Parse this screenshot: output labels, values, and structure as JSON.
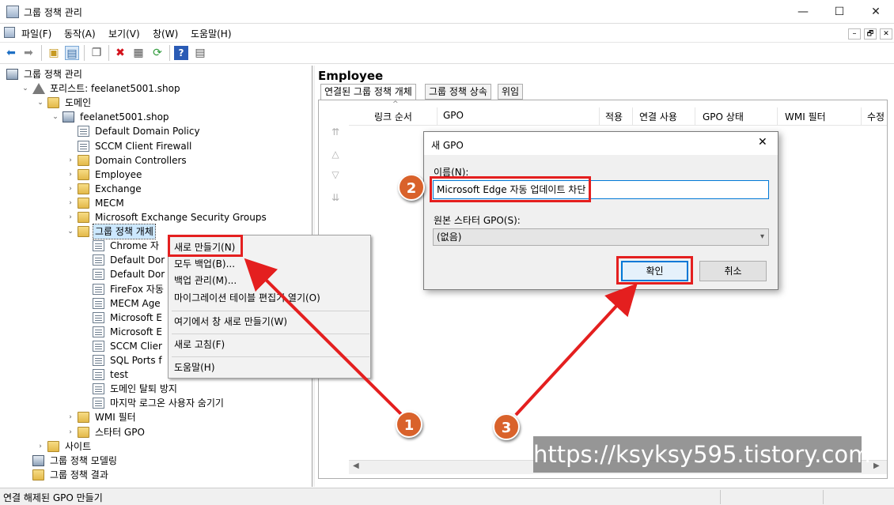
{
  "window": {
    "title": "그룹 정책 관리",
    "minimize": "—",
    "maximize": "☐",
    "close": "✕"
  },
  "menu": [
    "파일(F)",
    "동작(A)",
    "보기(V)",
    "창(W)",
    "도움말(H)"
  ],
  "mdi_controls": [
    "–",
    "🗗",
    "✕"
  ],
  "toolbar_icons": [
    "back-arrow-icon",
    "forward-arrow-icon",
    "folder-up-icon",
    "console-tree-icon",
    "copy-icon",
    "delete-icon",
    "properties-icon",
    "refresh-icon",
    "help-icon",
    "export-icon"
  ],
  "tree": [
    {
      "label": "그룹 정책 관리",
      "icon": "dom",
      "indent": 0,
      "twisty": ""
    },
    {
      "label": "포리스트: feelanet5001.shop",
      "icon": "tri",
      "indent": 1,
      "twisty": "⌄"
    },
    {
      "label": "도메인",
      "icon": "folder",
      "indent": 2,
      "twisty": "⌄"
    },
    {
      "label": "feelanet5001.shop",
      "icon": "dom",
      "indent": 3,
      "twisty": "⌄"
    },
    {
      "label": "Default Domain Policy",
      "icon": "doc",
      "indent": 4,
      "twisty": ""
    },
    {
      "label": "SCCM Client Firewall",
      "icon": "doc",
      "indent": 4,
      "twisty": ""
    },
    {
      "label": "Domain Controllers",
      "icon": "folder",
      "indent": 4,
      "twisty": "›"
    },
    {
      "label": "Employee",
      "icon": "folder",
      "indent": 4,
      "twisty": "›"
    },
    {
      "label": "Exchange",
      "icon": "folder",
      "indent": 4,
      "twisty": "›"
    },
    {
      "label": "MECM",
      "icon": "folder",
      "indent": 4,
      "twisty": "›"
    },
    {
      "label": "Microsoft Exchange Security Groups",
      "icon": "folder",
      "indent": 4,
      "twisty": "›"
    },
    {
      "label": "그룹 정책 개체",
      "icon": "folder",
      "indent": 4,
      "twisty": "⌄",
      "selected": true
    },
    {
      "label": "Chrome 자",
      "icon": "doc",
      "indent": 5,
      "twisty": ""
    },
    {
      "label": "Default Dor",
      "icon": "doc",
      "indent": 5,
      "twisty": ""
    },
    {
      "label": "Default Dor",
      "icon": "doc",
      "indent": 5,
      "twisty": ""
    },
    {
      "label": "FireFox 자동",
      "icon": "doc",
      "indent": 5,
      "twisty": ""
    },
    {
      "label": "MECM Age",
      "icon": "doc",
      "indent": 5,
      "twisty": ""
    },
    {
      "label": "Microsoft E",
      "icon": "doc",
      "indent": 5,
      "twisty": ""
    },
    {
      "label": "Microsoft E",
      "icon": "doc",
      "indent": 5,
      "twisty": ""
    },
    {
      "label": "SCCM Clier",
      "icon": "doc",
      "indent": 5,
      "twisty": ""
    },
    {
      "label": "SQL Ports f",
      "icon": "doc",
      "indent": 5,
      "twisty": ""
    },
    {
      "label": "test",
      "icon": "doc",
      "indent": 5,
      "twisty": ""
    },
    {
      "label": "도메인 탈퇴 방지",
      "icon": "doc",
      "indent": 5,
      "twisty": ""
    },
    {
      "label": "마지막 로그온 사용자 숨기기",
      "icon": "doc",
      "indent": 5,
      "twisty": ""
    },
    {
      "label": "WMI 필터",
      "icon": "folder",
      "indent": 4,
      "twisty": "›"
    },
    {
      "label": "스타터 GPO",
      "icon": "folder",
      "indent": 4,
      "twisty": "›"
    },
    {
      "label": "사이트",
      "icon": "folder",
      "indent": 2,
      "twisty": "›"
    },
    {
      "label": "그룹 정책 모델링",
      "icon": "dom",
      "indent": 1,
      "twisty": ""
    },
    {
      "label": "그룹 정책 결과",
      "icon": "folder",
      "indent": 1,
      "twisty": ""
    }
  ],
  "right": {
    "heading": "Employee",
    "tabs": [
      "연결된 그룹 정책 개체",
      "그룹 정책 상속",
      "위임"
    ],
    "columns": [
      "링크 순서",
      "GPO",
      "적용",
      "연결 사용",
      "GPO 상태",
      "WMI 필터",
      "수정"
    ],
    "order_arrows": [
      "⇈",
      "△",
      "▽",
      "⇊"
    ]
  },
  "context_menu": [
    "새로 만들기(N)",
    "모두 백업(B)...",
    "백업 관리(M)...",
    "마이그레이션 테이블 편집기 열기(O)",
    "여기에서 창 새로 만들기(W)",
    "새로 고침(F)",
    "도움말(H)"
  ],
  "dialog": {
    "title": "새 GPO",
    "name_label": "이름(N):",
    "name_value": "Microsoft Edge 자동 업데이트 차단",
    "source_label": "원본 스타터 GPO(S):",
    "source_value": "(없음)",
    "ok": "확인",
    "cancel": "취소",
    "close": "✕"
  },
  "badges": [
    "1",
    "2",
    "3"
  ],
  "status": "연결 해제된 GPO 만들기",
  "watermark": "https://ksyksy595.tistory.com",
  "colors": {
    "annotation_red": "#e41f1f",
    "badge_orange": "#d9622b",
    "selection": "#cce8ff",
    "focus_blue": "#0078d7"
  }
}
